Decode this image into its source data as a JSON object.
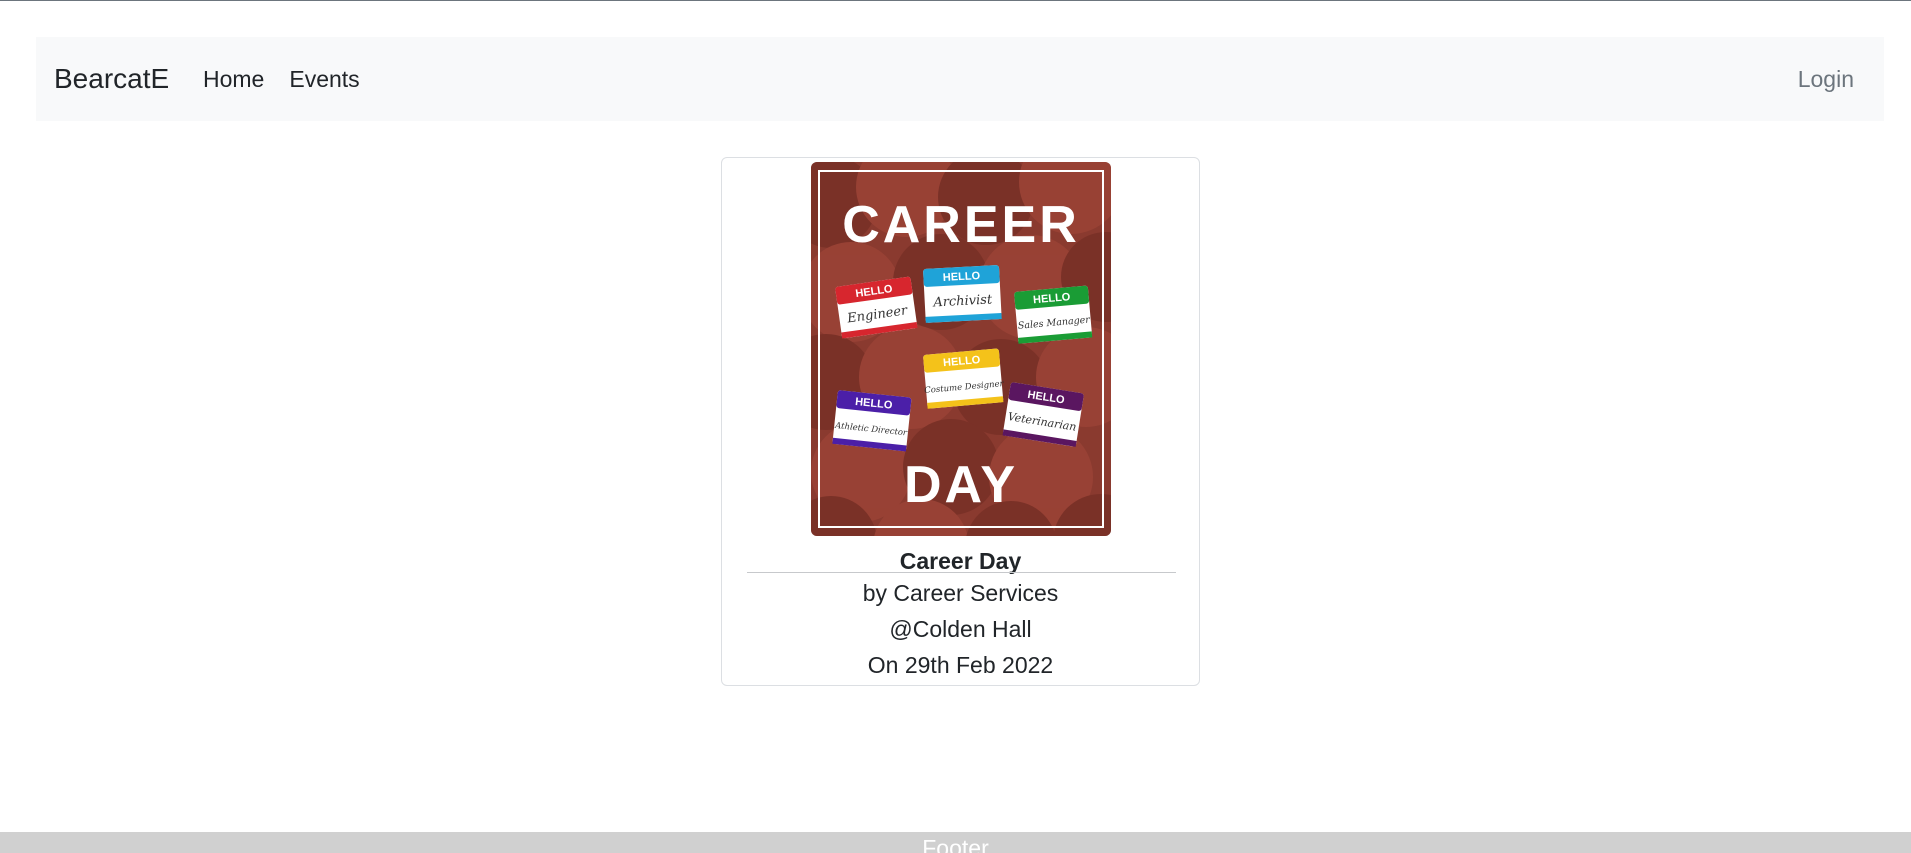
{
  "navbar": {
    "brand": "BearcatE",
    "links": [
      {
        "label": "Home"
      },
      {
        "label": "Events"
      }
    ],
    "login": "Login"
  },
  "event_card": {
    "poster": {
      "top_text": "CAREER",
      "bottom_text": "DAY",
      "tags": [
        {
          "header": "HELLO",
          "role": "Engineer",
          "color": "#d7262e"
        },
        {
          "header": "HELLO",
          "role": "Archivist",
          "color": "#1fa3d8"
        },
        {
          "header": "HELLO",
          "role": "Sales Manager",
          "color": "#1a9c35"
        },
        {
          "header": "HELLO",
          "role": "Costume Designer",
          "color": "#f4c21a"
        },
        {
          "header": "HELLO",
          "role": "Athletic Director",
          "color": "#4b1fa8"
        },
        {
          "header": "HELLO",
          "role": "Veterinarian",
          "color": "#5a1660"
        }
      ],
      "background_color": "#8a3a2f"
    },
    "title": "Career Day",
    "organizer": "by Career Services",
    "location": "@Colden Hall",
    "date": "On 29th Feb 2022"
  },
  "footer": {
    "text": "Footer"
  }
}
